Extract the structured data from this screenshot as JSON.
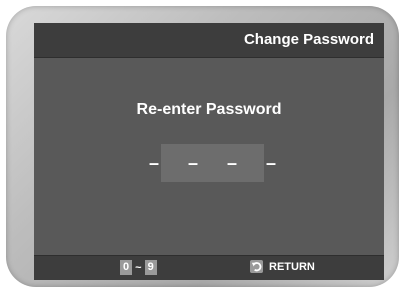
{
  "header": {
    "title": "Change Password"
  },
  "main": {
    "prompt": "Re-enter Password",
    "password_mask": "– – – –"
  },
  "footer": {
    "key_from": "0",
    "key_separator": "~",
    "key_to": "9",
    "return_label": "RETURN",
    "return_icon": "return-icon"
  }
}
